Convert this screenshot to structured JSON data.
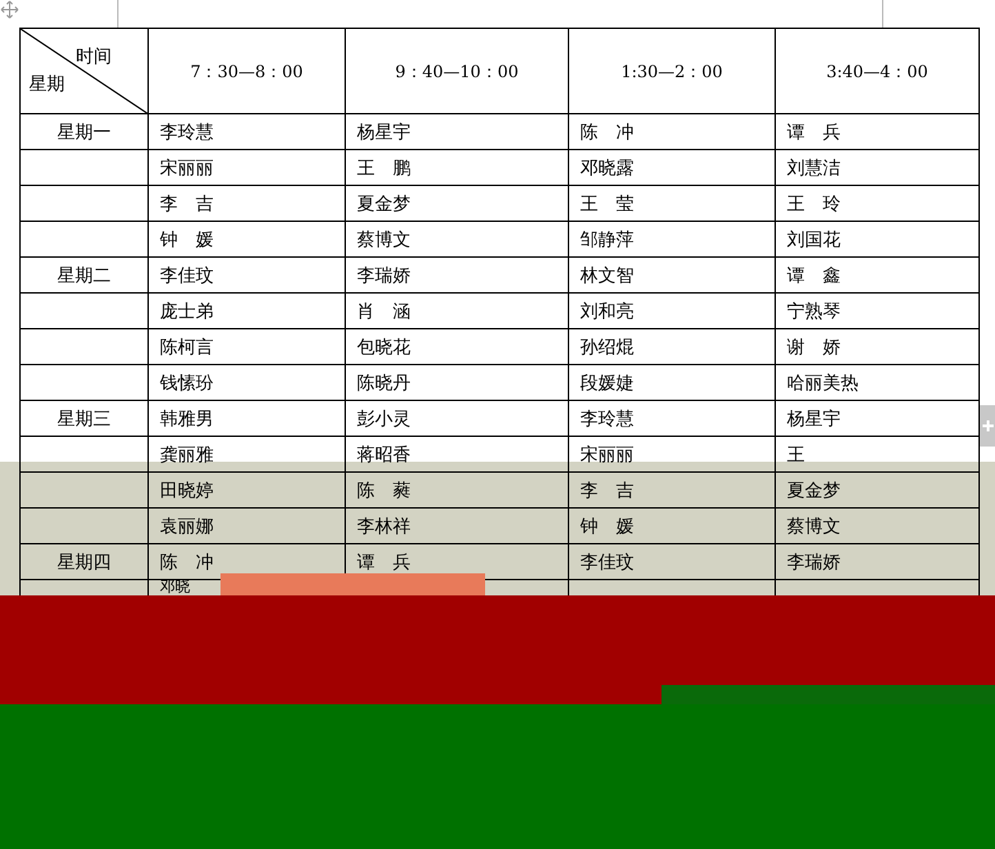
{
  "table": {
    "corner_top": "时间",
    "corner_bottom": "星期",
    "columns": [
      "7：30—8：00",
      "9：40—10：00",
      "1:30—2：00",
      "3:40—4：00"
    ],
    "rows": [
      {
        "day": "星期一",
        "cells": [
          "李玲慧",
          "杨星宇",
          "陈　冲",
          "谭　兵"
        ]
      },
      {
        "day": "",
        "cells": [
          "宋丽丽",
          "王　鹏",
          "邓晓露",
          "刘慧洁"
        ]
      },
      {
        "day": "",
        "cells": [
          "李　吉",
          "夏金梦",
          "王　莹",
          "王　玲"
        ]
      },
      {
        "day": "",
        "cells": [
          "钟　媛",
          "蔡博文",
          "邹静萍",
          "刘国花"
        ]
      },
      {
        "day": "星期二",
        "cells": [
          "李佳玟",
          "李瑞娇",
          "林文智",
          "谭　鑫"
        ]
      },
      {
        "day": "",
        "cells": [
          "庞士弟",
          "肖　涵",
          "刘和亮",
          "宁熟琴"
        ]
      },
      {
        "day": "",
        "cells": [
          "陈柯言",
          "包晓花",
          "孙绍焜",
          "谢　娇"
        ]
      },
      {
        "day": "",
        "cells": [
          "钱愫玢",
          "陈晓丹",
          "段媛婕",
          "哈丽美热"
        ]
      },
      {
        "day": "星期三",
        "cells": [
          "韩雅男",
          "彭小灵",
          "李玲慧",
          "杨星宇"
        ]
      },
      {
        "day": "",
        "cells": [
          "龚丽雅",
          "蒋昭香",
          "宋丽丽",
          "王"
        ]
      },
      {
        "day": "",
        "cells": [
          "田晓婷",
          "陈　蕤",
          "李　吉",
          "夏金梦"
        ]
      },
      {
        "day": "",
        "cells": [
          "袁丽娜",
          "李林祥",
          "钟　媛",
          "蔡博文"
        ]
      },
      {
        "day": "星期四",
        "cells": [
          "陈　冲",
          "谭　兵",
          "李佳玟",
          "李瑞娇"
        ]
      },
      {
        "day": "",
        "cells": [
          "邓晓",
          "",
          "",
          ""
        ]
      }
    ]
  }
}
